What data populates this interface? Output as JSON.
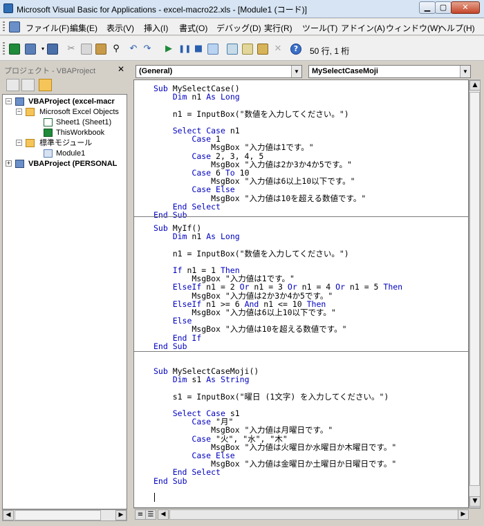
{
  "window": {
    "title": "Microsoft Visual Basic for Applications - excel-macro22.xls - [Module1 (コード)]"
  },
  "menu": {
    "items": [
      "ファイル(F)",
      "編集(E)",
      "表示(V)",
      "挿入(I)",
      "書式(O)",
      "デバッグ(D)",
      "実行(R)",
      "ツール(T)",
      "アドイン(A)",
      "ウィンドウ(W)",
      "ヘルプ(H)"
    ],
    "controls": [
      "-",
      "×"
    ]
  },
  "toolbar": {
    "cursor_position": "50 行, 1 桁"
  },
  "project_explorer": {
    "title": "プロジェクト - VBAProject",
    "tree": [
      {
        "label": "VBAProject (excel-macr",
        "icon": "vba-project-icon"
      },
      {
        "label": "Microsoft Excel Objects",
        "icon": "folder-icon"
      },
      {
        "label": "Sheet1 (Sheet1)",
        "icon": "worksheet-icon"
      },
      {
        "label": "ThisWorkbook",
        "icon": "workbook-icon"
      },
      {
        "label": "標準モジュール",
        "icon": "folder-icon"
      },
      {
        "label": "Module1",
        "icon": "module-icon"
      },
      {
        "label": "VBAProject (PERSONAL",
        "icon": "vba-project-icon"
      }
    ]
  },
  "code_window": {
    "object_combo": "(General)",
    "procedure_combo": "MySelectCaseMoji",
    "procedures": [
      {
        "name": "MySelectCase",
        "lines": [
          "Sub MySelectCase()",
          "    Dim n1 As Long",
          "",
          "    n1 = InputBox(\"数値を入力してください。\")",
          "",
          "    Select Case n1",
          "        Case 1",
          "            MsgBox \"入力値は1です。\"",
          "        Case 2, 3, 4, 5",
          "            MsgBox \"入力値は2か3か4か5です。\"",
          "        Case 6 To 10",
          "            MsgBox \"入力値は6以上10以下です。\"",
          "        Case Else",
          "            MsgBox \"入力値は10を超える数値です。\"",
          "    End Select",
          "End Sub"
        ]
      },
      {
        "name": "MyIf",
        "lines": [
          "Sub MyIf()",
          "    Dim n1 As Long",
          "",
          "    n1 = InputBox(\"数値を入力してください。\")",
          "",
          "    If n1 = 1 Then",
          "        MsgBox \"入力値は1です。\"",
          "    ElseIf n1 = 2 Or n1 = 3 Or n1 = 4 Or n1 = 5 Then",
          "        MsgBox \"入力値は2か3か4か5です。\"",
          "    ElseIf n1 >= 6 And n1 <= 10 Then",
          "        MsgBox \"入力値は6以上10以下です。\"",
          "    Else",
          "        MsgBox \"入力値は10を超える数値です。\"",
          "    End If",
          "End Sub",
          ""
        ]
      },
      {
        "name": "MySelectCaseMoji",
        "lines": [
          "Sub MySelectCaseMoji()",
          "    Dim s1 As String",
          "",
          "    s1 = InputBox(\"曜日 (1文字) を入力してください。\")",
          "",
          "    Select Case s1",
          "        Case \"月\"",
          "            MsgBox \"入力値は月曜日です。\"",
          "        Case \"火\", \"水\", \"木\"",
          "            MsgBox \"入力値は火曜日か水曜日か木曜日です。\"",
          "        Case Else",
          "            MsgBox \"入力値は金曜日か土曜日か日曜日です。\"",
          "    End Select",
          "End Sub"
        ]
      }
    ]
  },
  "colors": {
    "keyword": "#0000c0",
    "text": "#000000",
    "chrome": "#d4d0c8"
  }
}
